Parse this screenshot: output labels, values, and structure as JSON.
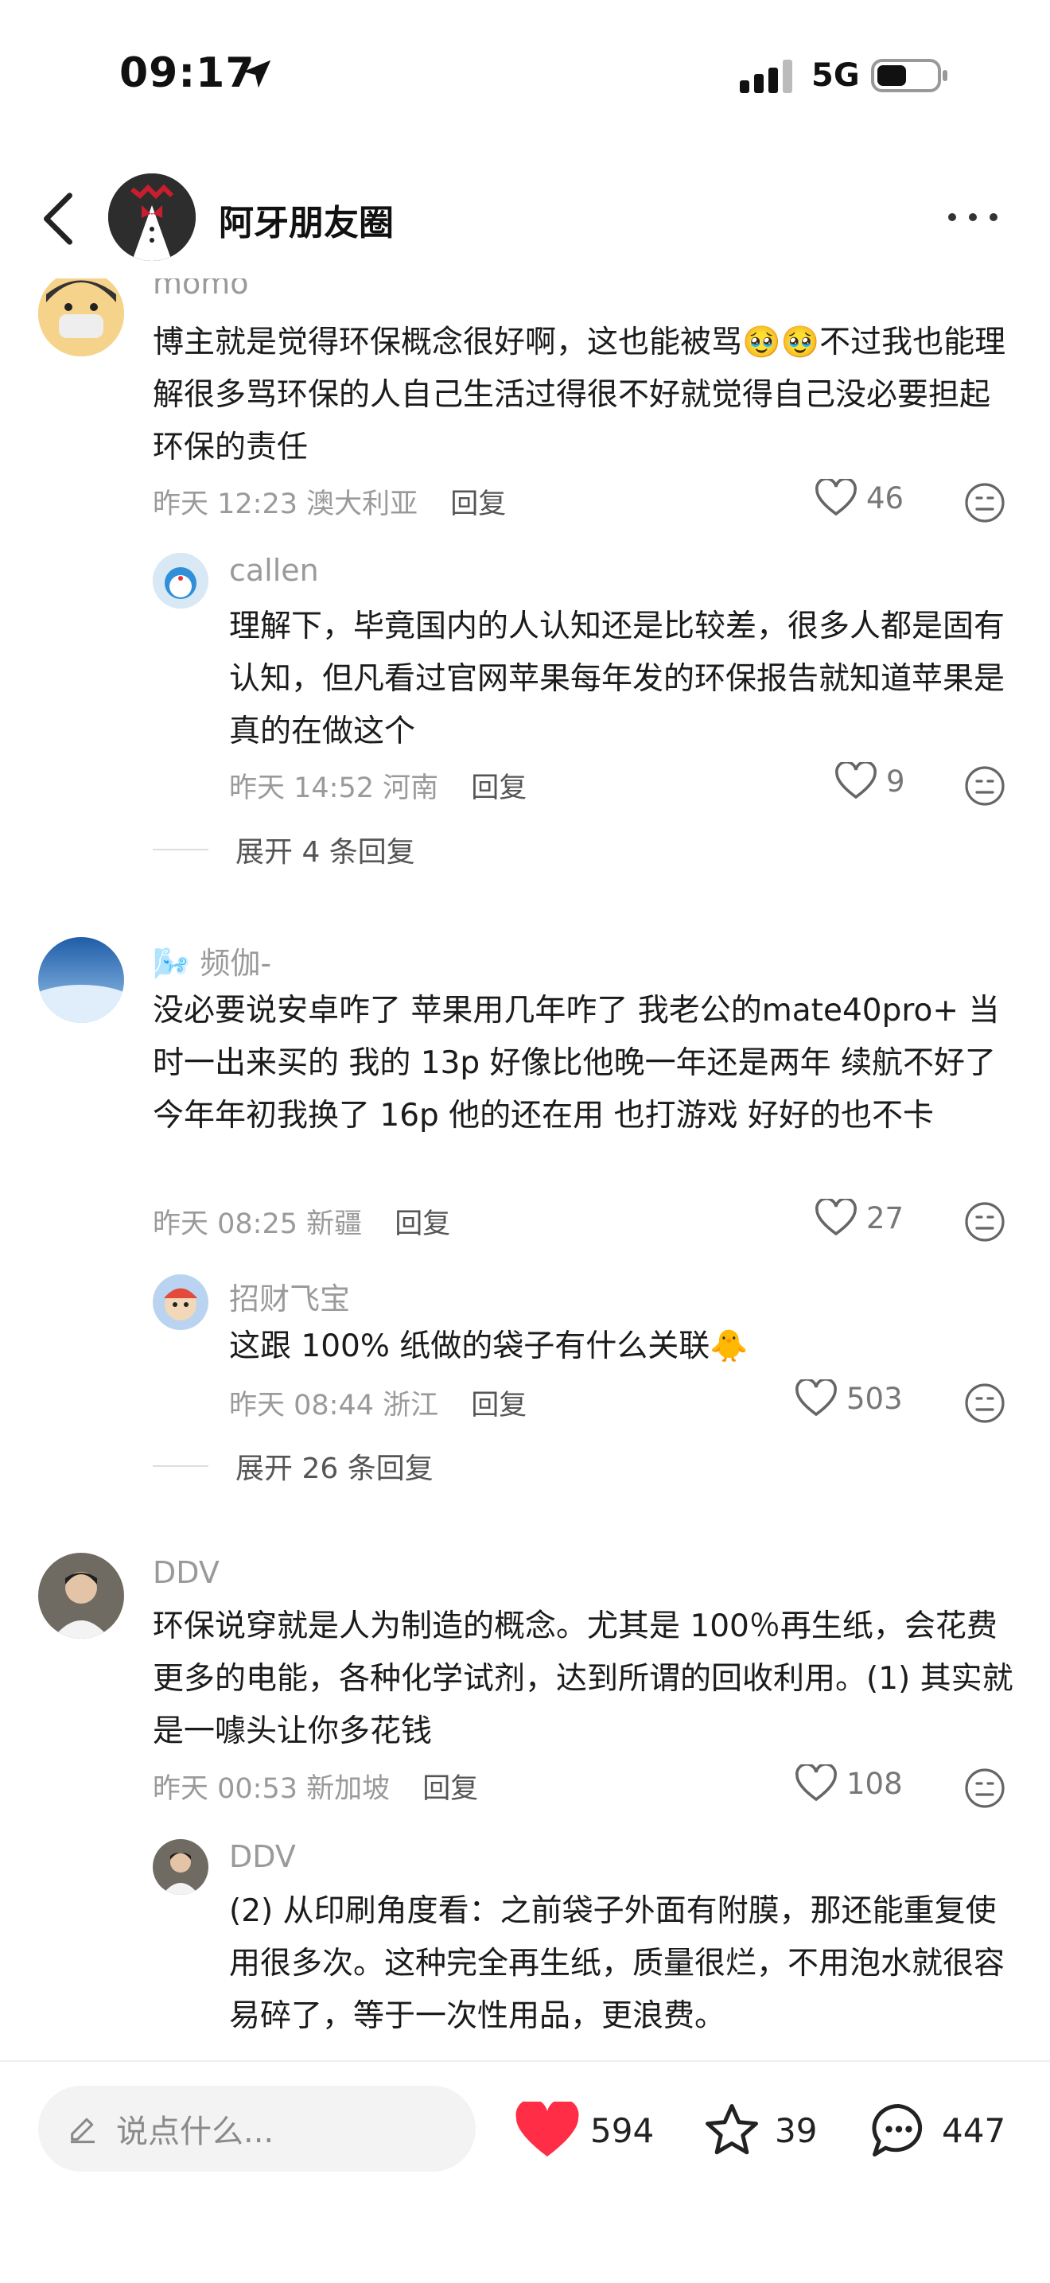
{
  "status_bar": {
    "time": "09:17",
    "network": "5G"
  },
  "header": {
    "title": "阿牙朋友圈"
  },
  "comments": [
    {
      "user": "momo",
      "text": "博主就是觉得环保概念很好啊，这也能被骂🥹🥹不过我也能理解很多骂环保的人自己生活过得很不好就觉得自己没必要担起环保的责任",
      "time": "昨天 12:23",
      "location": "澳大利亚",
      "reply_label": "回复",
      "likes": "46",
      "replies": [
        {
          "user": "callen",
          "text": "理解下，毕竟国内的人认知还是比较差，很多人都是固有认知，但凡看过官网苹果每年发的环保报告就知道苹果是真的在做这个",
          "time": "昨天 14:52",
          "location": "河南",
          "reply_label": "回复",
          "likes": "9"
        }
      ],
      "expand": "展开 4 条回复"
    },
    {
      "user": "🌬️ 频伽-",
      "text": "没必要说安卓咋了 苹果用几年咋了  我老公的mate40pro+ 当时一出来买的  我的 13p 好像比他晚一年还是两年  续航不好了  今年年初我换了 16p  他的还在用  也打游戏  好好的也不卡",
      "time": "昨天 08:25",
      "location": "新疆",
      "reply_label": "回复",
      "likes": "27",
      "replies": [
        {
          "user": "招财飞宝",
          "text": "这跟 100% 纸做的袋子有什么关联🐥",
          "time": "昨天 08:44",
          "location": "浙江",
          "reply_label": "回复",
          "likes": "503"
        }
      ],
      "expand": "展开 26 条回复"
    },
    {
      "user": "DDV",
      "text": "环保说穿就是人为制造的概念。尤其是 100％再生纸，会花费更多的电能，各种化学试剂，达到所谓的回收利用。(1) 其实就是一噱头让你多花钱",
      "time": "昨天 00:53",
      "location": "新加坡",
      "reply_label": "回复",
      "likes": "108",
      "replies": [
        {
          "user": "DDV",
          "text": "(2) 从印刷角度看：之前袋子外面有附膜，那还能重复使用很多次。这种完全再生纸，质量很烂，不用泡水就很容易碎了，等于一次性用品，更浪费。"
        }
      ]
    }
  ],
  "bottom_bar": {
    "input_placeholder": "说点什么...",
    "likes": "594",
    "favorites": "39",
    "comments": "447"
  },
  "colors": {
    "like_red": "#ff2d46",
    "text_gray": "#9a9a9a"
  }
}
